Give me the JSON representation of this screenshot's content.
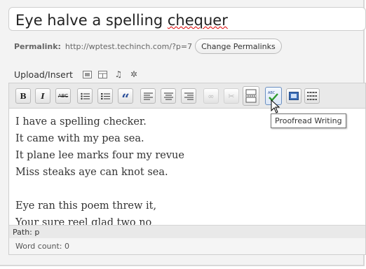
{
  "post": {
    "title_prefix": "Eye halve a spelling ",
    "title_misspelled": "chequer"
  },
  "permalink": {
    "label": "Permalink:",
    "url": "http://wptest.techinch.com/?p=7",
    "change_button": "Change Permalinks"
  },
  "media": {
    "label": "Upload/Insert",
    "icons": [
      "image-icon",
      "media-icon",
      "audio-icon",
      "other-media-icon"
    ]
  },
  "toolbar": {
    "buttons": [
      {
        "name": "bold-button",
        "glyph": "B"
      },
      {
        "name": "italic-button",
        "glyph": "I"
      },
      {
        "name": "strikethrough-button",
        "glyph": "ABC"
      },
      {
        "name": "bullet-list-button",
        "glyph": "☰"
      },
      {
        "name": "numbered-list-button",
        "glyph": "☰"
      },
      {
        "name": "blockquote-button",
        "glyph": "“"
      },
      {
        "name": "align-left-button",
        "glyph": "≡"
      },
      {
        "name": "align-center-button",
        "glyph": "≡"
      },
      {
        "name": "align-right-button",
        "glyph": "≡"
      },
      {
        "name": "insert-link-button",
        "glyph": "∞"
      },
      {
        "name": "unlink-button",
        "glyph": "✂"
      },
      {
        "name": "insert-more-button",
        "glyph": "▭"
      },
      {
        "name": "proofread-button",
        "glyph": "✔"
      },
      {
        "name": "fullscreen-button",
        "glyph": "▣"
      },
      {
        "name": "kitchen-sink-button",
        "glyph": "▦"
      }
    ]
  },
  "content": {
    "lines": [
      "I have a spelling checker.",
      "It came with my pea sea.",
      "It plane lee marks four my revue",
      "Miss steaks aye can knot sea.",
      "",
      "Eye ran this poem threw it,",
      "Your sure reel glad two no"
    ]
  },
  "tooltip": "Proofread Writing",
  "status": {
    "path": "Path: p",
    "word_count": "Word count: 0"
  }
}
